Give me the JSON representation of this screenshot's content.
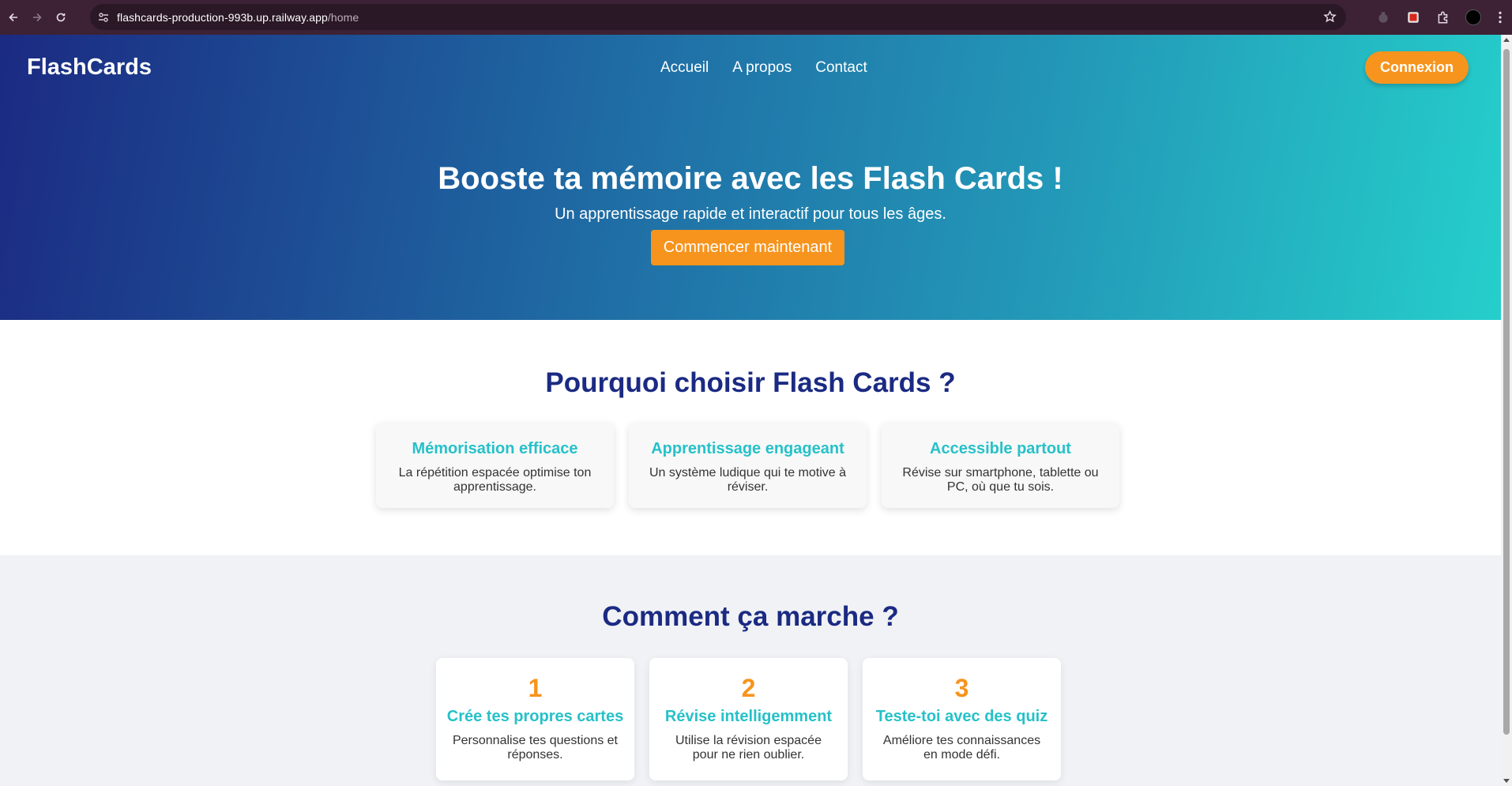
{
  "browser": {
    "url_host": "flashcards-production-993b.up.railway.app",
    "url_path": "/home"
  },
  "site": {
    "logo": "FlashCards",
    "nav": [
      "Accueil",
      "A propos",
      "Contact"
    ],
    "login_label": "Connexion"
  },
  "hero": {
    "title": "Booste ta mémoire avec les Flash Cards !",
    "subtitle": "Un apprentissage rapide et interactif pour tous les âges.",
    "cta_label": "Commencer maintenant"
  },
  "why": {
    "title": "Pourquoi choisir Flash Cards ?",
    "cards": [
      {
        "title": "Mémorisation efficace",
        "text": "La répétition espacée optimise ton apprentissage."
      },
      {
        "title": "Apprentissage engageant",
        "text": "Un système ludique qui te motive à réviser."
      },
      {
        "title": "Accessible partout",
        "text": "Révise sur smartphone, tablette ou PC, où que tu sois."
      }
    ]
  },
  "how": {
    "title": "Comment ça marche ?",
    "steps": [
      {
        "num": "1",
        "title": "Crée tes propres cartes",
        "text": "Personnalise tes questions et réponses."
      },
      {
        "num": "2",
        "title": "Révise intelligemment",
        "text": "Utilise la révision espacée pour ne rien oublier."
      },
      {
        "num": "3",
        "title": "Teste-toi avec des quiz",
        "text": "Améliore tes connaissances en mode défi."
      }
    ]
  },
  "colors": {
    "primary_dark": "#1b2a82",
    "accent_orange": "#f7941d",
    "accent_teal": "#26c1c9"
  }
}
